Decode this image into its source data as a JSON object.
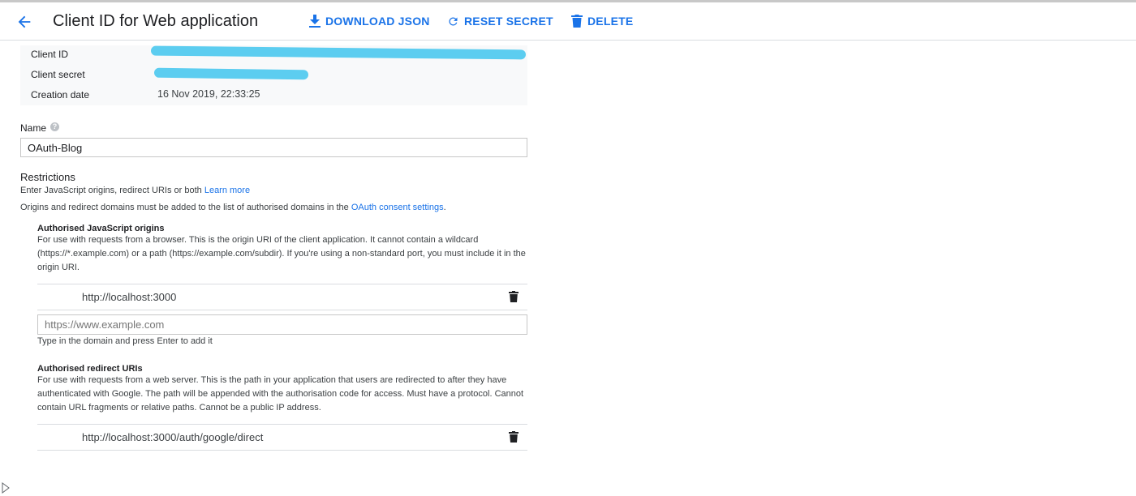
{
  "header": {
    "title": "Client ID for Web application",
    "actions": {
      "download": "DOWNLOAD JSON",
      "reset": "RESET SECRET",
      "delete": "DELETE"
    }
  },
  "info": {
    "rows": [
      {
        "label": "Client ID",
        "value": ""
      },
      {
        "label": "Client secret",
        "value": ""
      },
      {
        "label": "Creation date",
        "value": "16 Nov 2019, 22:33:25"
      }
    ]
  },
  "name_field": {
    "label": "Name",
    "value": "OAuth-Blog"
  },
  "restrictions": {
    "title": "Restrictions",
    "line1_text": "Enter JavaScript origins, redirect URIs or both",
    "line1_link": "Learn more",
    "line2_text": "Origins and redirect domains must be added to the list of authorised domains in the",
    "line2_link": "OAuth consent settings",
    "line2_end": "."
  },
  "js_origins": {
    "title": "Authorised JavaScript origins",
    "description": "For use with requests from a browser. This is the origin URI of the client application. It cannot contain a wildcard (https://*.example.com) or a path (https://example.com/subdir). If you're using a non-standard port, you must include it in the origin URI.",
    "items": [
      "http://localhost:3000"
    ],
    "input_placeholder": "https://www.example.com",
    "hint": "Type in the domain and press Enter to add it"
  },
  "redirect_uris": {
    "title": "Authorised redirect URIs",
    "description": "For use with requests from a web server. This is the path in your application that users are redirected to after they have authenticated with Google. The path will be appended with the authorisation code for access. Must have a protocol. Cannot contain URL fragments or relative paths. Cannot be a public IP address.",
    "items": [
      "http://localhost:3000/auth/google/direct"
    ]
  },
  "colors": {
    "accent": "#1a73e8",
    "redaction": "#5ccdf0",
    "table_bg": "#f8f9fa"
  },
  "icons": {
    "back": "arrow-left-icon",
    "download": "download-icon",
    "reset": "refresh-icon",
    "delete": "trash-icon",
    "help": "help-circle-icon"
  }
}
